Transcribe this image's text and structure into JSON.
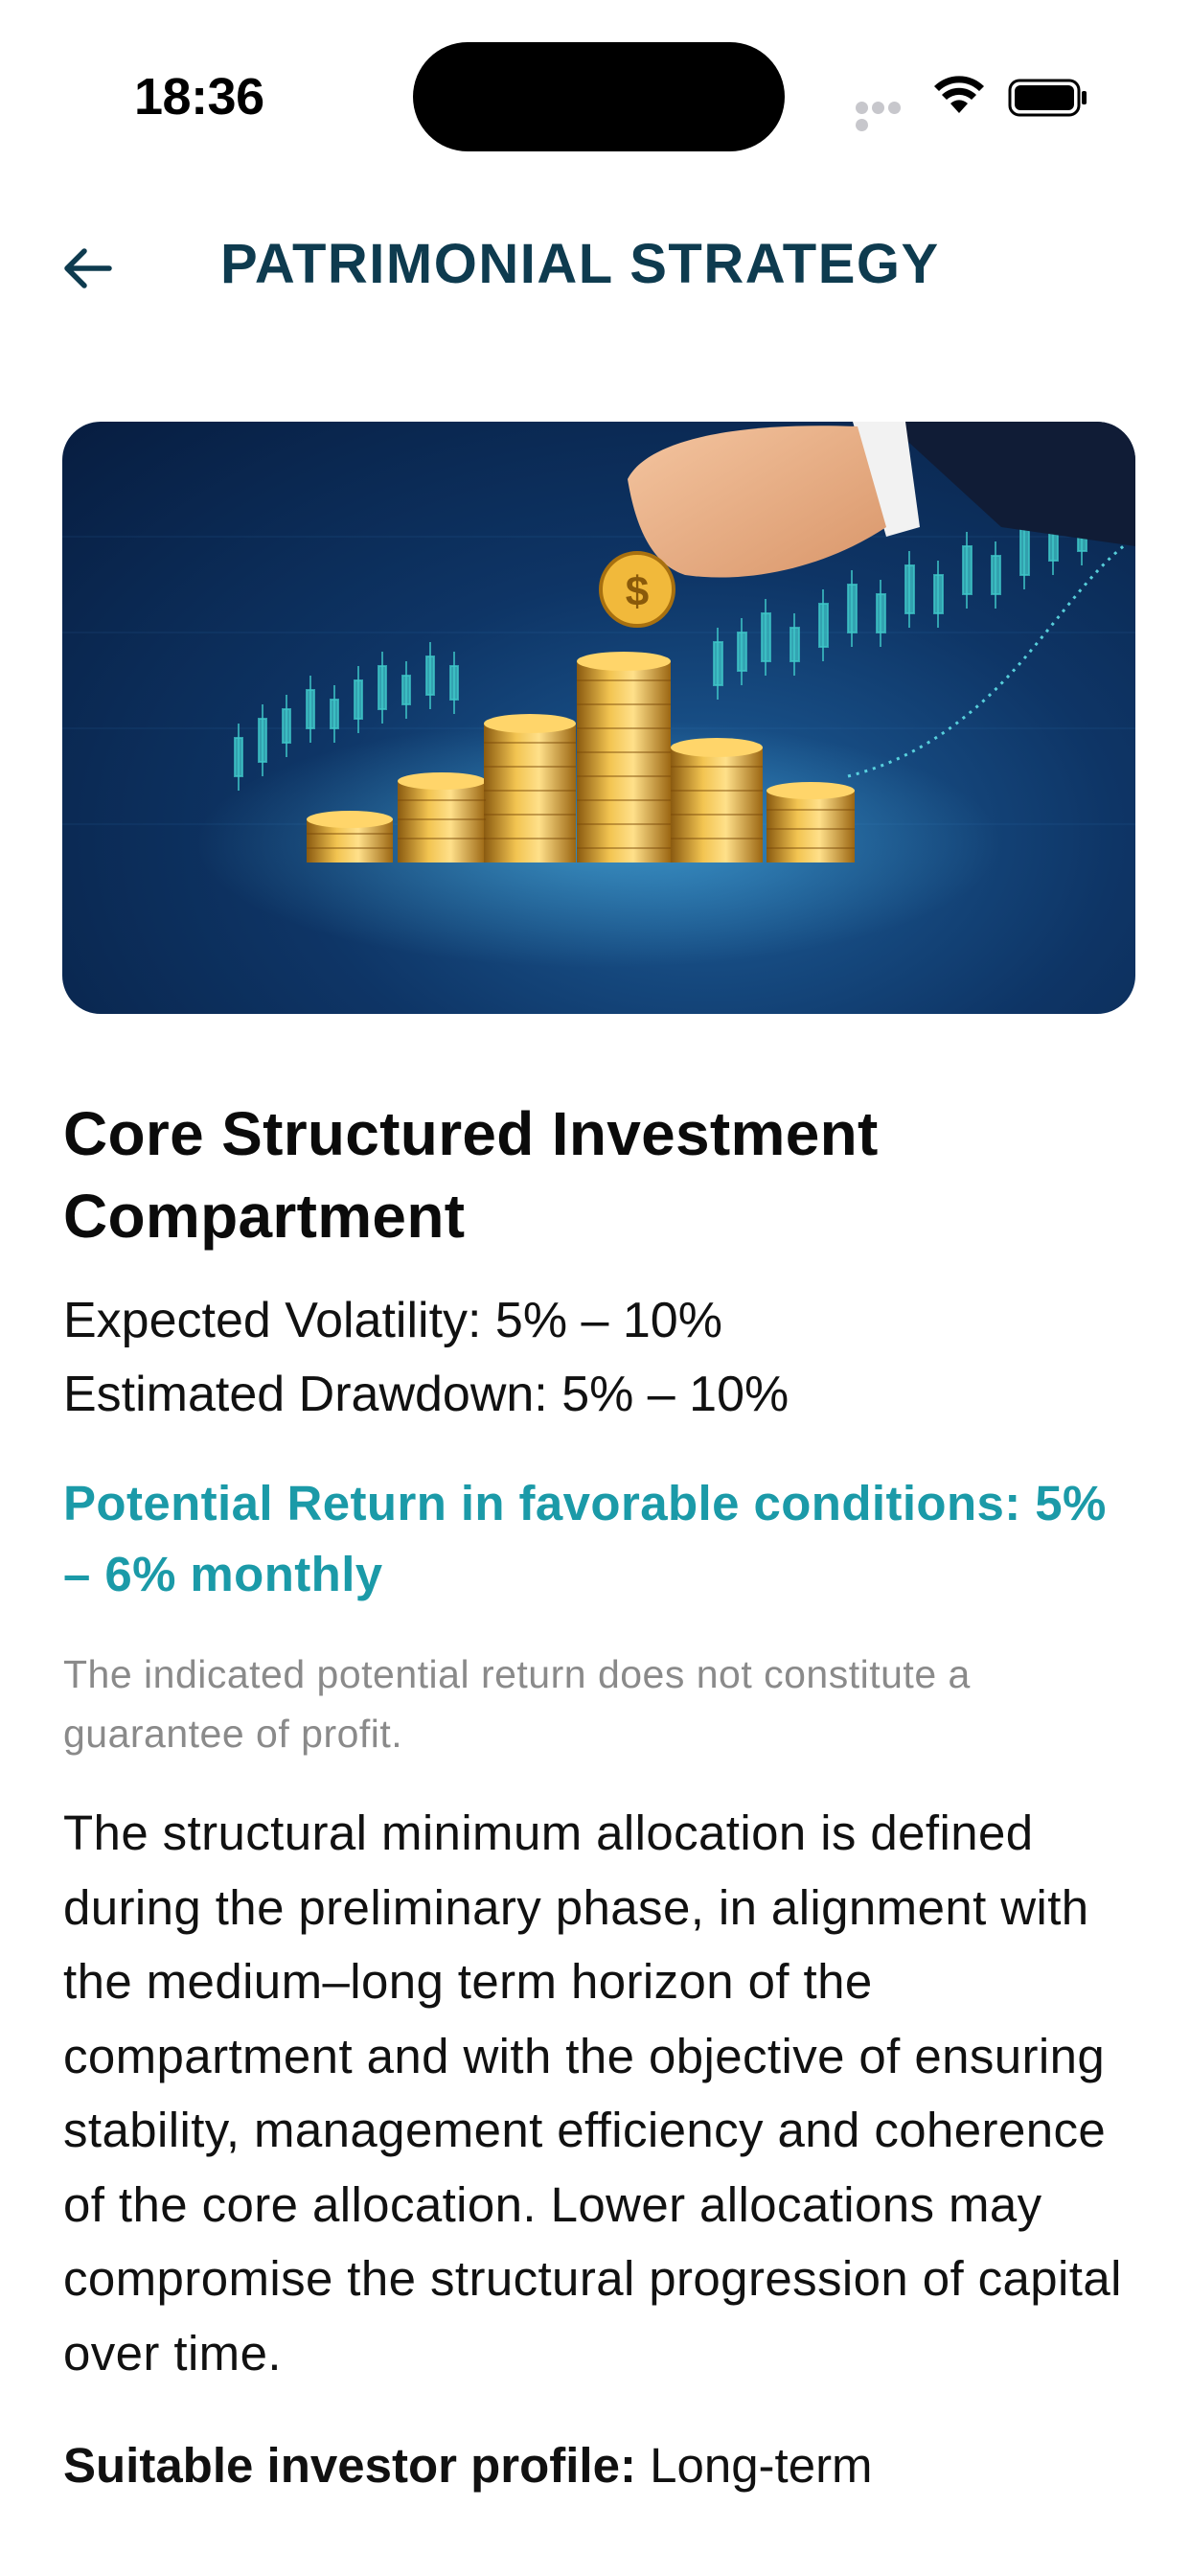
{
  "status_bar": {
    "time": "18:36"
  },
  "header": {
    "title": "PATRIMONIAL STRATEGY",
    "back_icon": "arrow-left-icon"
  },
  "hero": {
    "icon": "coin-stacks-chart-image"
  },
  "card": {
    "title": "Core Structured Investment Compartment",
    "expected_volatility": "Expected Volatility: 5% – 10%",
    "estimated_drawdown": "Estimated Drawdown: 5% – 10%",
    "potential_return": "Potential Return in favorable conditions: 5% – 6% monthly",
    "disclaimer": "The indicated potential return does not constitute a guarantee of profit.",
    "description": "The structural minimum allocation is defined during the preliminary phase, in alignment with the medium–long term horizon of the compartment and with the objective of ensuring stability, management efficiency and coherence of the core allocation. Lower allocations may compromise the structural progression of capital over time.",
    "next_heading_bold": "Suitable investor profile:",
    "next_heading_rest": " Long-term"
  },
  "colors": {
    "title": "#0e3b4f",
    "accent": "#1b9aa8",
    "disclaimer": "#8a8a8a"
  }
}
